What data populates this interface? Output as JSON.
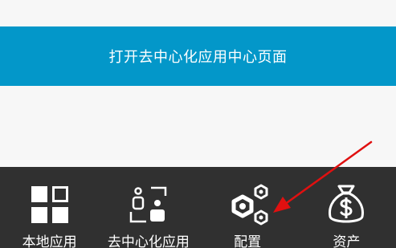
{
  "banner": {
    "label": "打开去中心化应用中心页面"
  },
  "tabs": [
    {
      "label": "本地应用",
      "icon": "grid-icon"
    },
    {
      "label": "去中心化应用",
      "icon": "dapp-icon"
    },
    {
      "label": "配置",
      "icon": "settings-gears-icon"
    },
    {
      "label": "资产",
      "icon": "money-bag-icon"
    }
  ],
  "colors": {
    "banner": "#0397c9",
    "tabbar": "#303030",
    "background": "#f7f7f7",
    "annotation_arrow": "#e01010"
  }
}
